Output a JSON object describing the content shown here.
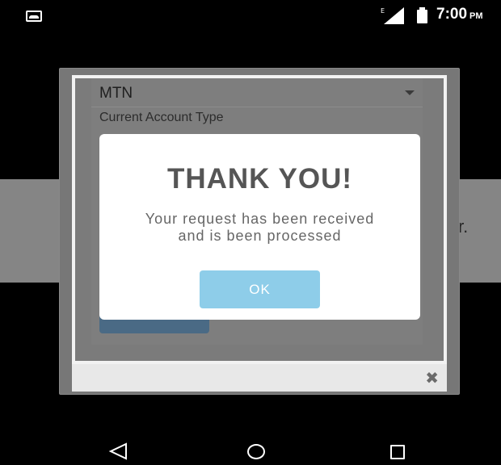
{
  "status_bar": {
    "network": "E",
    "time": "7:00",
    "ampm": "PM"
  },
  "background": {
    "partial_text": "r."
  },
  "form": {
    "network_select_value": "MTN",
    "account_type_label": "Current Account Type"
  },
  "modal": {
    "title": "THANK YOU!",
    "message": "Your request has been received and is been processed",
    "ok_label": "OK"
  },
  "colors": {
    "ok_button": "#8ecde9",
    "modal_bg": "#ffffff",
    "overlay": "#7b7b7b"
  },
  "icons": {
    "status_left": "image-notification-icon",
    "signal": "signal-icon",
    "battery": "battery-icon",
    "close": "close-icon",
    "back": "back-icon",
    "home": "home-icon",
    "recent": "recent-apps-icon"
  }
}
